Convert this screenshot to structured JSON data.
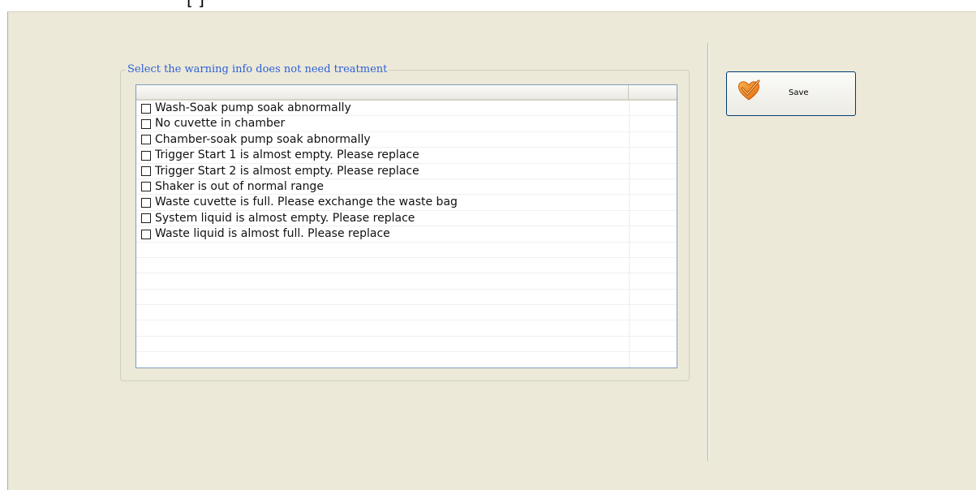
{
  "page_title_fragment": "[ ]",
  "warnings": {
    "group_title": "Select the warning info does not need treatment",
    "items": [
      {
        "label": "Wash-Soak pump soak abnormally",
        "checked": false
      },
      {
        "label": "No cuvette in chamber",
        "checked": false
      },
      {
        "label": "Chamber-soak pump soak abnormally",
        "checked": false
      },
      {
        "label": "Trigger Start 1 is almost empty. Please replace",
        "checked": false
      },
      {
        "label": "Trigger Start 2 is almost empty. Please replace",
        "checked": false
      },
      {
        "label": "Shaker is out of normal range",
        "checked": false
      },
      {
        "label": "Waste cuvette is full. Please exchange the waste bag",
        "checked": false
      },
      {
        "label": "System liquid is almost empty. Please replace",
        "checked": false
      },
      {
        "label": "Waste liquid is almost full. Please replace",
        "checked": false
      }
    ],
    "empty_rows": 8
  },
  "toolbar": {
    "save_label": "Save",
    "save_icon": "heart-check-icon"
  },
  "colors": {
    "panel_background": "#ece9d8",
    "group_title": "#2d5fd6",
    "list_border": "#7f9db9",
    "button_border": "#003c74",
    "icon_orange": "#f08a1c"
  }
}
